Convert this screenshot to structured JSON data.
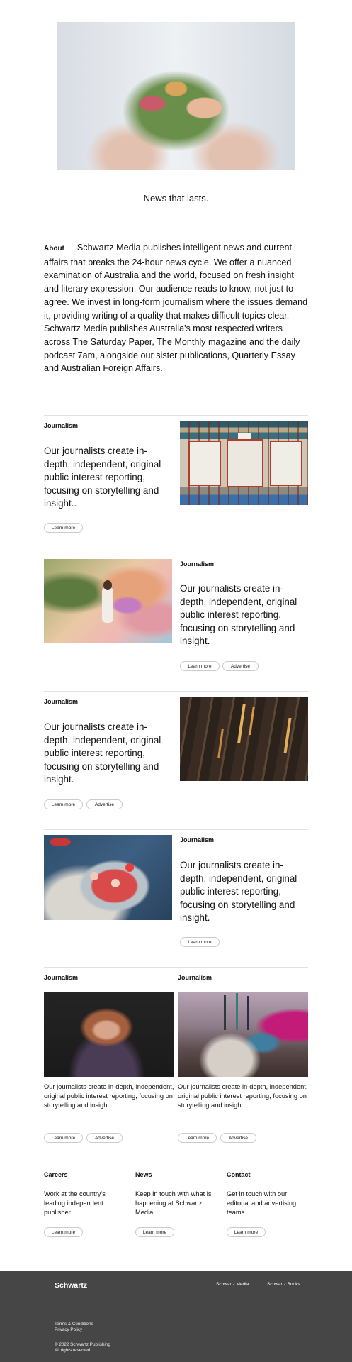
{
  "tagline": "News that lasts.",
  "about": {
    "label": "About",
    "text": "Schwartz Media publishes intelligent news and current affairs that breaks the 24-hour news cycle. We offer a nuanced examination of Australia and the world, focused on fresh insight and literary expression. Our audience reads to know, not just to agree. We invest in long-form journalism where the issues demand it, providing writing of a quality that makes difficult topics clear. Schwartz Media publishes Australia's most respected writers across The Saturday Paper, The Monthly magazine and the daily podcast 7am, alongside our sister publications, Quarterly Essay and Australian Foreign Affairs."
  },
  "features": [
    {
      "kicker": "Journalism",
      "text": "Our journalists create in-depth, independent, original public interest reporting, focusing on storytelling and insight..",
      "learn": "Learn more"
    },
    {
      "kicker": "Journalism",
      "text": "Our journalists create in-depth, independent, original public interest reporting, focusing on storytelling and insight.",
      "learn": "Learn more",
      "advertise": "Advertise"
    },
    {
      "kicker": "Journalism",
      "text": "Our journalists create in-depth, independent, original public interest reporting, focusing on storytelling and insight.",
      "learn": "Learn more",
      "advertise": "Advertise"
    },
    {
      "kicker": "Journalism",
      "text": "Our journalists create in-depth, independent, original public interest reporting, focusing on storytelling and insight.",
      "learn": "Learn more"
    }
  ],
  "cards": [
    {
      "kicker": "Journalism",
      "text": "Our journalists create in-depth, independent, original public interest reporting, focusing on storytelling and insight.",
      "learn": "Learn more",
      "advertise": "Advertise"
    },
    {
      "kicker": "Journalism",
      "text": "Our journalists create in-depth, independent, original public interest reporting, focusing on storytelling and insight.",
      "learn": "Learn more",
      "advertise": "Advertise"
    }
  ],
  "columns": [
    {
      "title": "Careers",
      "text": "Work at the country's leading independent publisher.",
      "learn": "Learn more"
    },
    {
      "title": "News",
      "text": "Keep in touch with what is happening at Schwartz Media.",
      "learn": "Learn more"
    },
    {
      "title": "Contact",
      "text": "Get in touch with our editorial and advertising teams.",
      "learn": "Learn more"
    }
  ],
  "footer": {
    "logo": "Schwartz",
    "links": [
      "Schwartz Media",
      "Schwartz Books"
    ],
    "terms": "Terms & Conditions",
    "privacy": "Privacy Policy",
    "copyright": "© 2022 Schwartz Publishing",
    "rights": "All rights reserved",
    "background": "#464646"
  }
}
